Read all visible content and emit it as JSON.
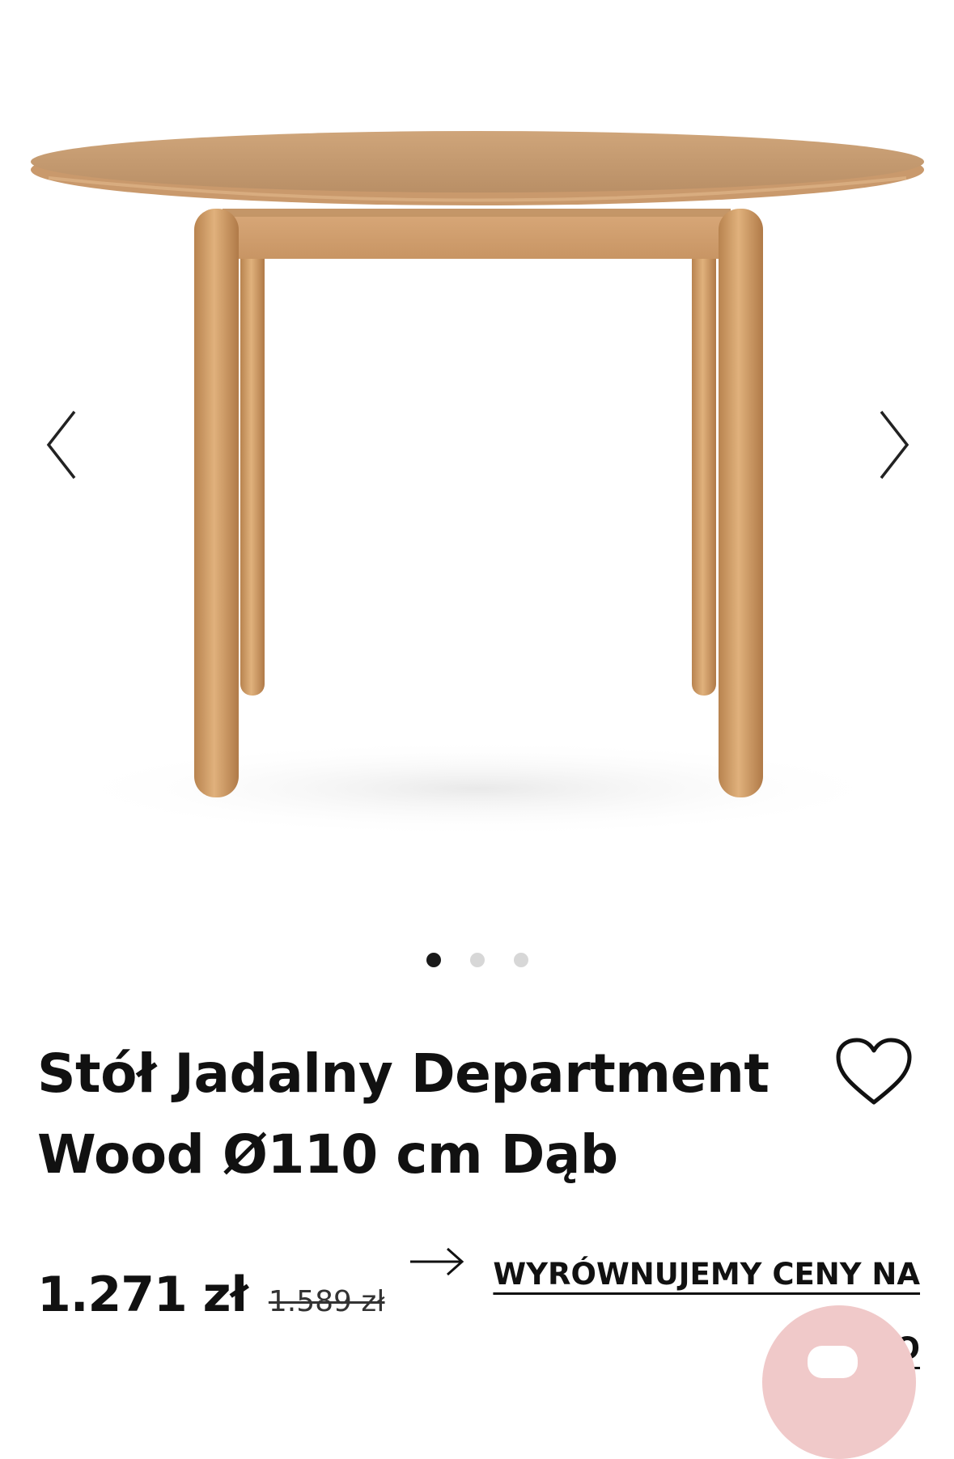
{
  "product": {
    "title_line1": "Stół Jadalny Department",
    "title_line2": "Wood Ø110 cm Dąb",
    "price_current": "1.271 zł",
    "price_old": "1.589 zł",
    "image_alt": "Stół Jadalny Department Wood Ø110 cm Dąb"
  },
  "gallery": {
    "total_images": 3,
    "active_index": 0,
    "prev_icon": "chevron-left-icon",
    "next_icon": "chevron-right-icon"
  },
  "price_match": {
    "label": "WYRÓWNUJEMY CENY NA ... WO",
    "icon": "arrow-right-icon"
  },
  "colors": {
    "text": "#111111",
    "dot_active": "#1a1a1a",
    "dot_inactive": "#d7d7d7",
    "chat_bubble": "#f0c9c9",
    "wood": "#d2a26a"
  }
}
